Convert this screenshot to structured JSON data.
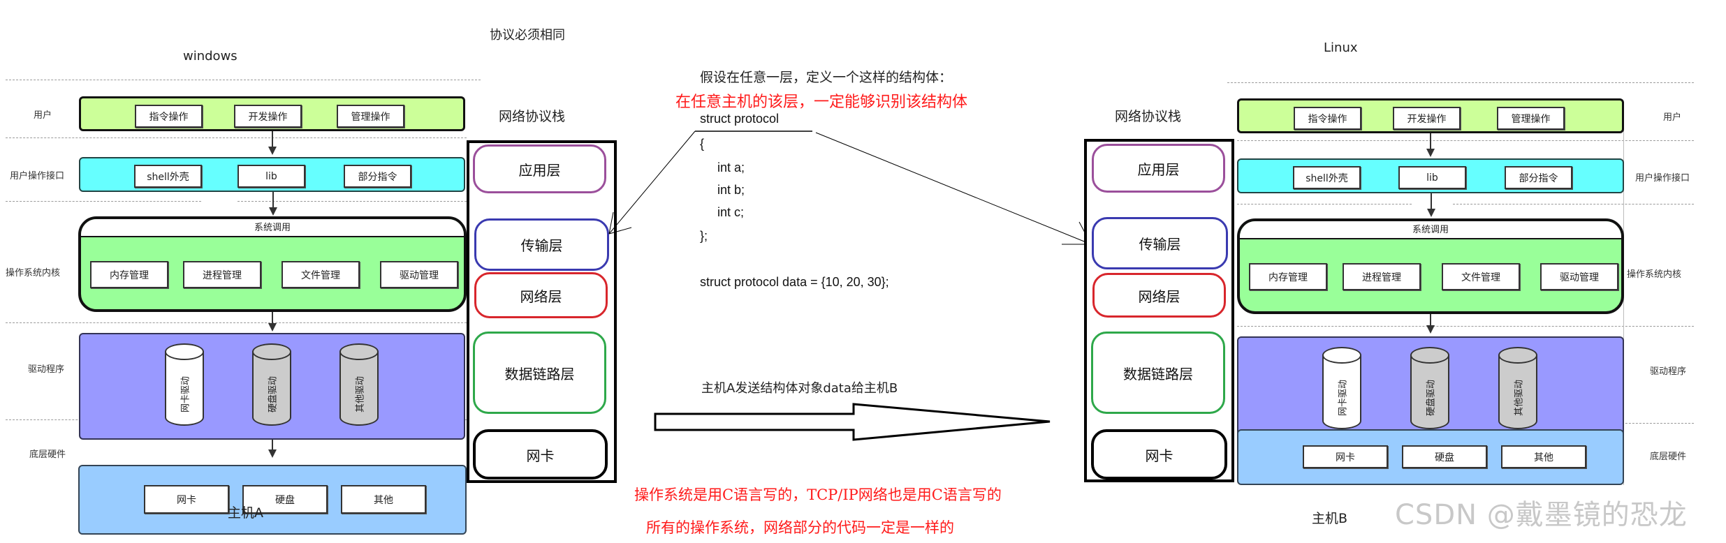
{
  "top_note": "协议必须相同",
  "hosts": {
    "left": {
      "os_name": "windows",
      "host_label": "主机A"
    },
    "right": {
      "os_name": "Linux",
      "host_label": "主机B"
    }
  },
  "row_labels": {
    "user": "用户",
    "api": "用户操作接口",
    "kernel": "操作系统内核",
    "driver": "驱动程序",
    "hardware": "底层硬件"
  },
  "user_items": [
    "指令操作",
    "开发操作",
    "管理操作"
  ],
  "api_items": [
    "shell外壳",
    "lib",
    "部分指令"
  ],
  "syscall_label": "系统调用",
  "kernel_items": [
    "内存管理",
    "进程管理",
    "文件管理",
    "驱动管理"
  ],
  "driver_items": [
    {
      "label": "网卡驱动",
      "style": "white"
    },
    {
      "label": "硬盘驱动",
      "style": "gray"
    },
    {
      "label": "其他驱动",
      "style": "gray"
    }
  ],
  "hardware_items": [
    "网卡",
    "硬盘",
    "其他"
  ],
  "stack": {
    "title": "网络协议栈",
    "layers": [
      {
        "name": "应用层",
        "color": "#9b4f9b"
      },
      {
        "name": "传输层",
        "color": "#3a3ab0"
      },
      {
        "name": "网络层",
        "color": "#d8262c"
      },
      {
        "name": "数据链路层",
        "color": "#2ea84a"
      },
      {
        "name": "网卡",
        "color": "#000000"
      }
    ]
  },
  "center": {
    "intro": "假设在任意一层，定义一个这样的结构体：",
    "red_claim": "在任意主机的该层，一定能够识别该结构体",
    "code_lines": [
      "struct protocol",
      "{",
      "int a;",
      "int b;",
      "int c;",
      "};"
    ],
    "data_line": "struct protocol data = {10, 20, 30};",
    "send_caption": "主机A发送结构体对象data给主机B",
    "red_note_1": "操作系统是用C语言写的，TCP/IP网络也是用C语言写的",
    "red_note_2": "所有的操作系统，网络部分的代码一定是一样的"
  },
  "watermark": "CSDN @戴墨镜的恐龙",
  "colors": {
    "user_band": "#ccff99",
    "api_band": "#66ffff",
    "kernel_band": "#99ff99",
    "driver_band": "#9999ff",
    "hardware_band": "#99ccff",
    "red_text": "#ff1a1a"
  }
}
